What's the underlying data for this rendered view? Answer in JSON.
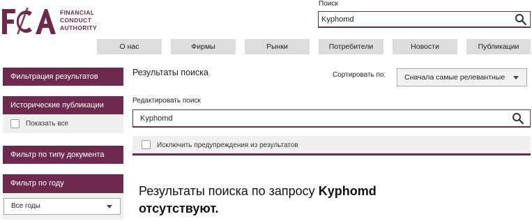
{
  "logo": {
    "mark": "FCA",
    "lines": [
      "FINANCIAL",
      "CONDUCT",
      "AUTHORITY"
    ]
  },
  "top_search": {
    "label": "Поиск",
    "value": "Kyphomd"
  },
  "nav": [
    "О нас",
    "Фирмы",
    "Рынки",
    "Потребители",
    "Новости",
    "Публикации"
  ],
  "sidebar": {
    "filter_results": "Фильтрация результатов",
    "historical": "Исторические публикации",
    "show_all": "Показать все",
    "doc_type": "Фильтр по типу документа",
    "year_filter": "Фильтр по году",
    "year_value": "Все годы"
  },
  "main": {
    "title": "Результаты поиска",
    "sort_label": "Сортировать по:",
    "sort_value": "Сначала самые релевантные",
    "edit_label": "Редактировать поиск",
    "search_value": "Kyphomd",
    "exclude_label": "Исключить предупреждения из результатов",
    "no_results_prefix": "Результаты поиска по запросу",
    "no_results_query": "Kyphomd",
    "no_results_suffix": "отсутствуют."
  },
  "colors": {
    "brand": "#6e2a4e",
    "tab_bg": "#dcdcdc",
    "panel_bg": "#f0f0f0"
  }
}
